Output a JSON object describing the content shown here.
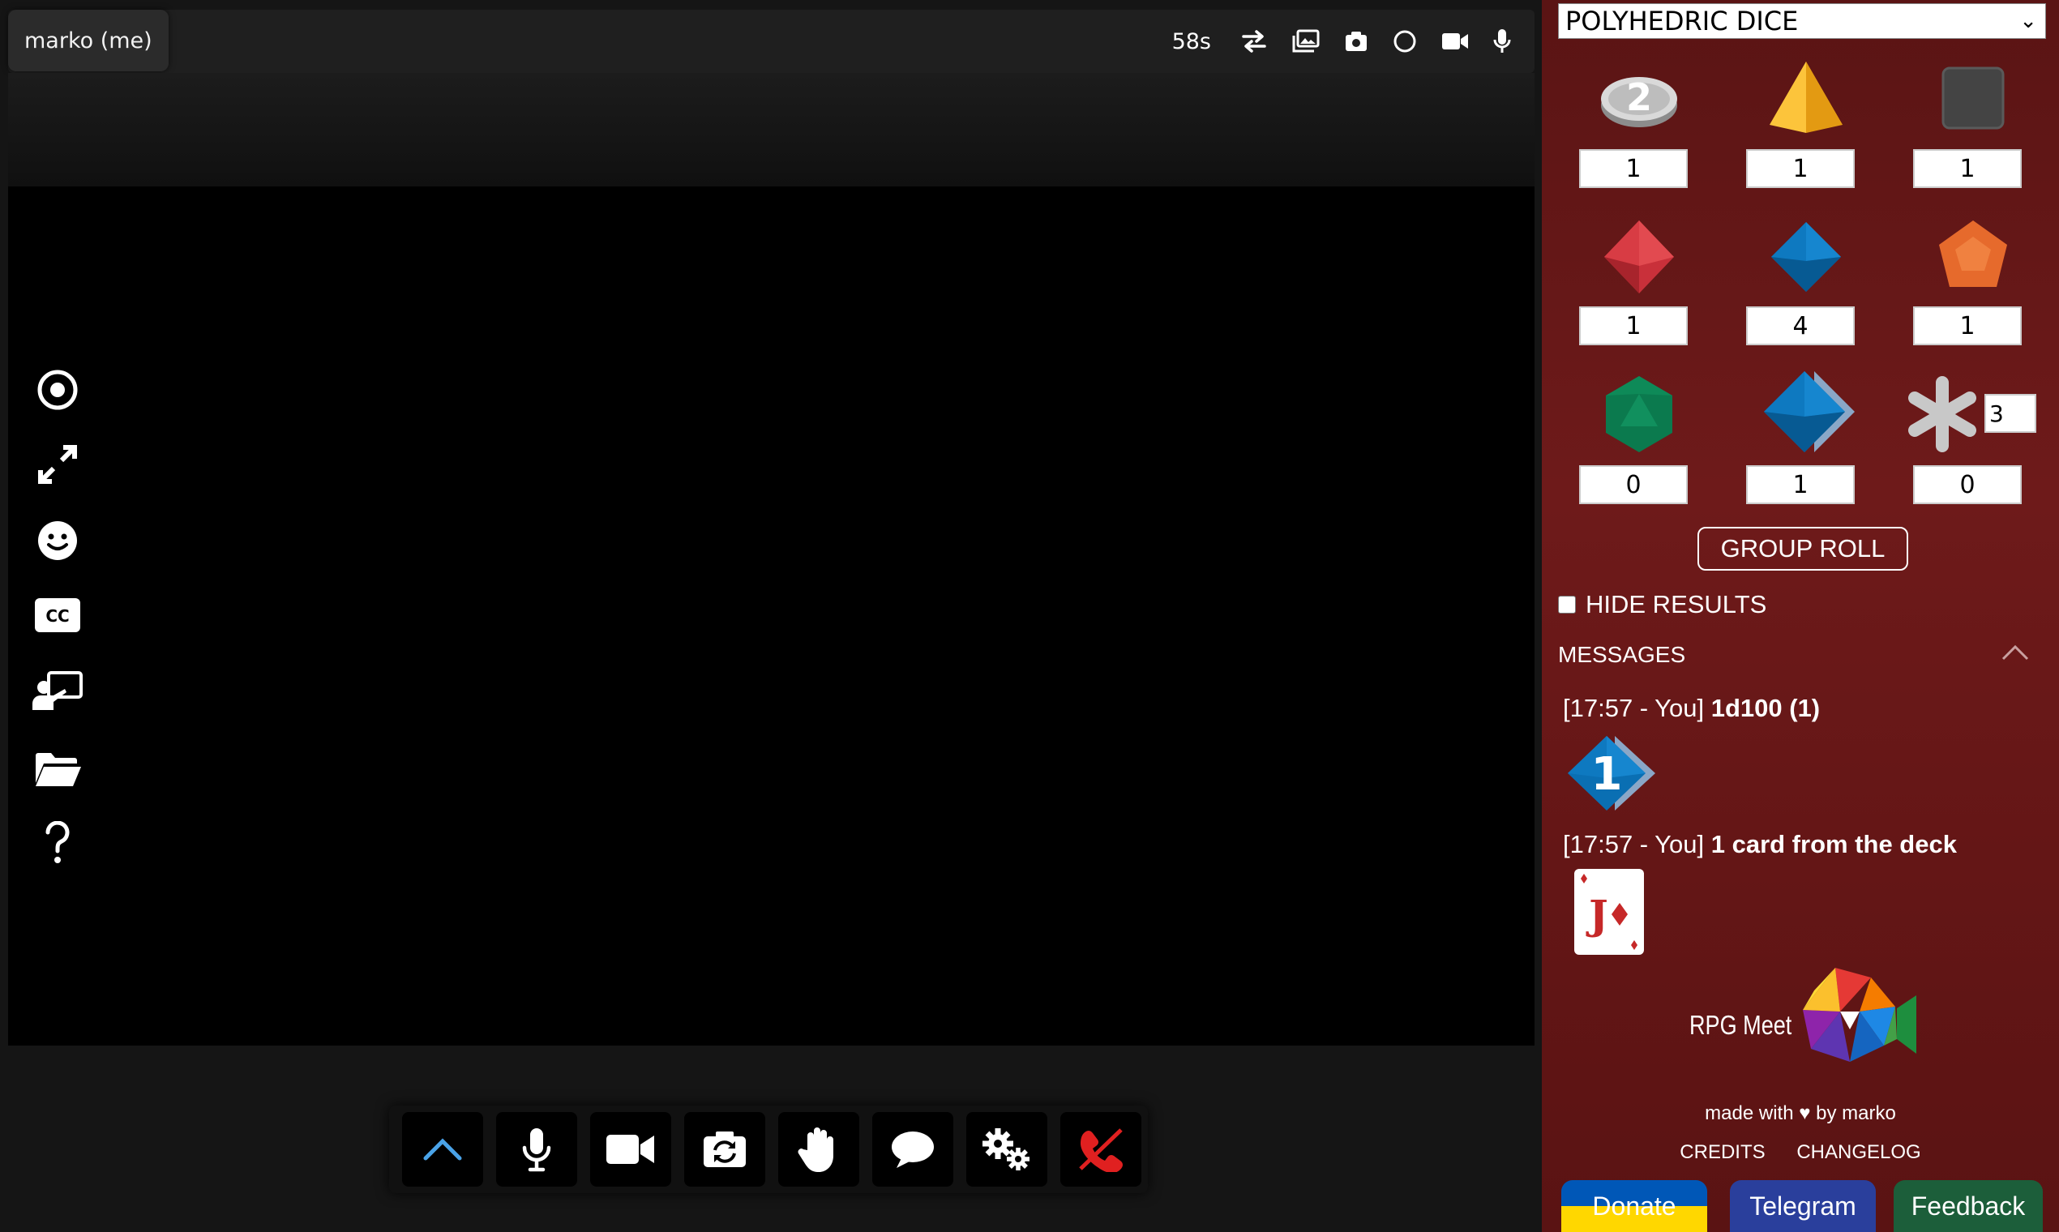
{
  "call": {
    "user_label": "marko (me)",
    "timer": "58s",
    "top_icons": [
      "switch-icon",
      "image-icon",
      "camera-snapshot-icon",
      "record-circle-icon",
      "video-camera-icon",
      "microphone-icon"
    ],
    "left_tools": [
      "target-icon",
      "fullscreen-icon",
      "emoji-icon",
      "captions-icon",
      "present-screen-icon",
      "folder-icon",
      "help-icon"
    ],
    "bottom_controls": [
      "chevron-up-icon",
      "microphone-icon",
      "video-camera-icon",
      "switch-camera-icon",
      "raise-hand-icon",
      "chat-icon",
      "settings-icon",
      "hang-up-icon"
    ]
  },
  "panel": {
    "dice_set": "POLYHEDRIC DICE",
    "dice": [
      {
        "name": "coin",
        "count": "1"
      },
      {
        "name": "d4",
        "count": "1"
      },
      {
        "name": "d6",
        "count": "1"
      },
      {
        "name": "d8",
        "count": "1"
      },
      {
        "name": "d10",
        "count": "4"
      },
      {
        "name": "d12",
        "count": "1"
      },
      {
        "name": "d20",
        "count": "0"
      },
      {
        "name": "d100",
        "count": "1"
      },
      {
        "name": "custom",
        "count": "0"
      }
    ],
    "coin_label": "2",
    "custom_sides": "3",
    "group_roll": "GROUP ROLL",
    "hide_results": "HIDE RESULTS",
    "messages_title": "MESSAGES",
    "messages": [
      {
        "prefix": "[17:57 - You]",
        "text": "1d100 (1)",
        "result": "1"
      },
      {
        "prefix": "[17:57 - You]",
        "text": "1 card from the deck",
        "card": "J"
      }
    ],
    "brand": "RPG Meet",
    "credit": "made with ♥ by marko",
    "links": [
      "CREDITS",
      "CHANGELOG"
    ],
    "buttons": [
      "Donate",
      "Telegram",
      "Feedback"
    ],
    "colors": {
      "donate_blue": "#0057b7",
      "donate_yellow": "#ffd700",
      "telegram": "#2a3f9c",
      "feedback": "#1c5e3a",
      "hangup": "#e02020",
      "accent_blue": "#4aa3e8"
    }
  }
}
